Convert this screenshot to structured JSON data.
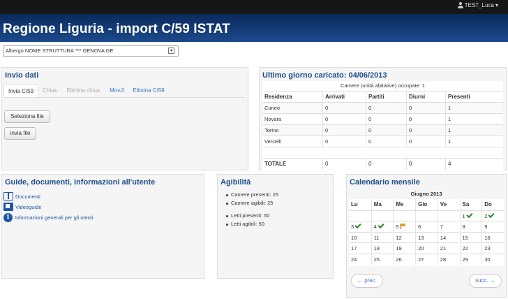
{
  "user": {
    "name": "TEST_Luca",
    "caret": "▾"
  },
  "header": {
    "title": "Regione Liguria - import C/59 ISTAT"
  },
  "structure_select": {
    "value": "Albergo NOME STRUTTURA *** GENOVA GE",
    "arrow": "▾"
  },
  "invio": {
    "title": "Invio dati",
    "tabs": [
      "Invia C/59",
      "Chius.",
      "Elimina chius.",
      "Mov.0",
      "Elimina C/59"
    ],
    "select_file_label": "Seleziona file",
    "send_file_label": "invia file"
  },
  "ultimo": {
    "title": "Ultimo giorno caricato: 04/06/2013",
    "caption": "Camere (unità abitative) occupate: 1",
    "headers": [
      "Residenza",
      "Arrivati",
      "Partiti",
      "Diurni",
      "Presenti"
    ],
    "rows": [
      [
        "Cuneo",
        "0",
        "0",
        "0",
        "1"
      ],
      [
        "Novara",
        "0",
        "0",
        "0",
        "1"
      ],
      [
        "Torino",
        "0",
        "0",
        "0",
        "1"
      ],
      [
        "Vercelli",
        "0",
        "0",
        "0",
        "1"
      ]
    ],
    "total": [
      "TOTALE",
      "0",
      "0",
      "0",
      "4"
    ]
  },
  "guide": {
    "title": "Guide, documenti, informazioni all'utente",
    "links": [
      "Documenti",
      "Videoguide",
      "Informazioni generali per gli utenti"
    ]
  },
  "agibilita": {
    "title": "Agibilità",
    "items": [
      "Camere presenti: 25",
      "Camere agibili: 25",
      "Letti presenti: 50",
      "Letti agibili: 50"
    ]
  },
  "calendar": {
    "title": "Calendario mensile",
    "month": "Giugno 2013",
    "weekdays": [
      "Lu",
      "Ma",
      "Me",
      "Gio",
      "Ve",
      "Sa",
      "Do"
    ],
    "weeks": [
      [
        "",
        "",
        "",
        "",
        "",
        "1",
        "2"
      ],
      [
        "3",
        "4",
        "5",
        "6",
        "7",
        "8",
        "9"
      ],
      [
        "10",
        "11",
        "12",
        "13",
        "14",
        "15",
        "16"
      ],
      [
        "17",
        "18",
        "19",
        "20",
        "21",
        "22",
        "23"
      ],
      [
        "24",
        "25",
        "26",
        "27",
        "28",
        "29",
        "30"
      ]
    ],
    "checked_days": [
      "1",
      "2",
      "3",
      "4"
    ],
    "flagged_days": [
      "5"
    ],
    "prev_label": "← prec.",
    "next_label": "succ. →"
  },
  "colors": {
    "header_dark": "#0a2a5c",
    "header_light": "#1c4a8c",
    "accent": "#1d4f8c",
    "link": "#3575c6",
    "check": "#2a8a2a",
    "flag": "#e6a019"
  }
}
